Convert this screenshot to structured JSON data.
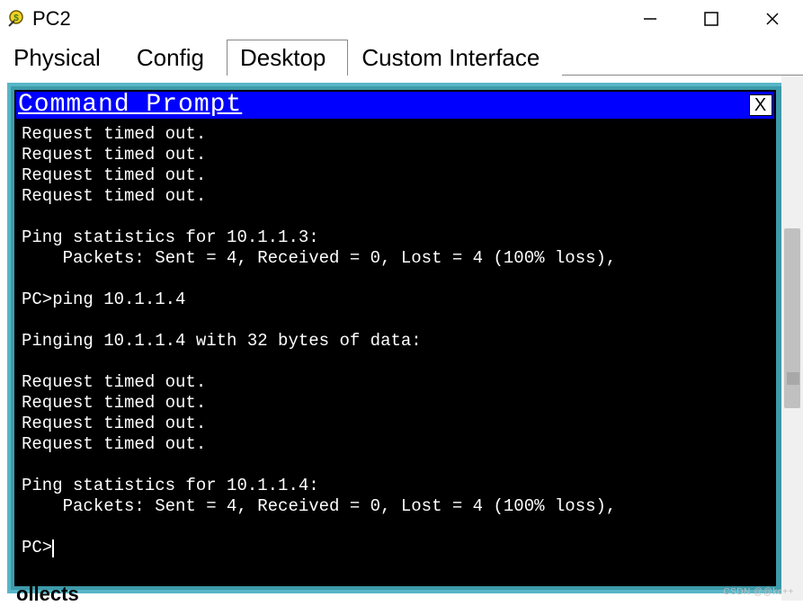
{
  "window": {
    "title": "PC2",
    "icon_name": "packet-tracer-pc-icon"
  },
  "tabs": {
    "items": [
      {
        "label": "Physical",
        "active": false
      },
      {
        "label": "Config",
        "active": false
      },
      {
        "label": "Desktop",
        "active": true
      },
      {
        "label": "Custom Interface",
        "active": false
      }
    ]
  },
  "command_prompt": {
    "title": "Command Prompt",
    "close_label": "X",
    "output": "Request timed out.\nRequest timed out.\nRequest timed out.\nRequest timed out.\n\nPing statistics for 10.1.1.3:\n    Packets: Sent = 4, Received = 0, Lost = 4 (100% loss),\n\nPC>ping 10.1.1.4\n\nPinging 10.1.1.4 with 32 bytes of data:\n\nRequest timed out.\nRequest timed out.\nRequest timed out.\nRequest timed out.\n\nPing statistics for 10.1.1.4:\n    Packets: Sent = 4, Received = 0, Lost = 4 (100% loss),\n\nPC>"
  },
  "truncated_footer": "ollects",
  "watermark": "CSDN @@kc++"
}
